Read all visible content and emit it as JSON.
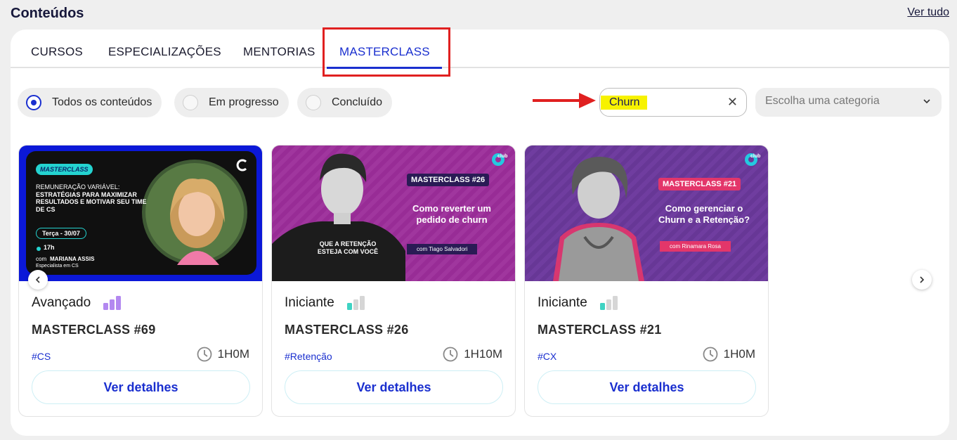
{
  "header": {
    "title": "Conteúdos",
    "see_all": "Ver tudo"
  },
  "tabs": [
    {
      "label": "CURSOS"
    },
    {
      "label": "ESPECIALIZAÇÕES"
    },
    {
      "label": "MENTORIAS"
    },
    {
      "label": "MASTERCLASS",
      "active": true
    }
  ],
  "filters": [
    {
      "label": "Todos os conteúdos",
      "checked": true
    },
    {
      "label": "Em progresso",
      "checked": false
    },
    {
      "label": "Concluído",
      "checked": false
    }
  ],
  "search": {
    "value": "Churn",
    "clear_icon": "close-icon"
  },
  "category": {
    "placeholder": "Escolha uma categoria",
    "icon": "chevron-down-icon"
  },
  "cards": [
    {
      "level": "Avançado",
      "level_bars": 3,
      "level_color": "#b388f0",
      "title": "MASTERCLASS #69",
      "tag": "#CS",
      "duration": "1H0M",
      "button": "Ver detalhes",
      "thumb": {
        "badge": "MASTERCLASS",
        "headline_top": "REMUNERAÇÃO VARIÁVEL:",
        "headline": "ESTRATÉGIAS PARA MAXIMIZAR RESULTADOS E MOTIVAR SEU TIME DE CS",
        "date": "Terça - 30/07",
        "time": "17h",
        "with": "com",
        "speaker": "MARIANA ASSIS",
        "role": "Especialista em CS"
      }
    },
    {
      "level": "Iniciante",
      "level_bars": 1,
      "level_color": "#3fd3c3",
      "title": "MASTERCLASS #26",
      "tag": "#Retenção",
      "duration": "1H10M",
      "button": "Ver detalhes",
      "thumb": {
        "badge": "MASTERCLASS #26",
        "headline": "Como reverter um pedido de churn",
        "speaker_line": "com Tiago Salvadori",
        "shirt": "QUE A RETENÇÃO ESTEJA COM VOCÊ",
        "logo": "club"
      }
    },
    {
      "level": "Iniciante",
      "level_bars": 1,
      "level_color": "#3fd3c3",
      "title": "MASTERCLASS #21",
      "tag": "#CX",
      "duration": "1H0M",
      "button": "Ver detalhes",
      "thumb": {
        "badge": "MASTERCLASS #21",
        "headline": "Como gerenciar o Churn e a Retenção?",
        "speaker_line": "com Rinamara Rosa",
        "logo": "club"
      }
    }
  ],
  "colors": {
    "accent": "#1a2fcf",
    "highlight": "#e02020",
    "search_highlight": "#f7f200"
  }
}
